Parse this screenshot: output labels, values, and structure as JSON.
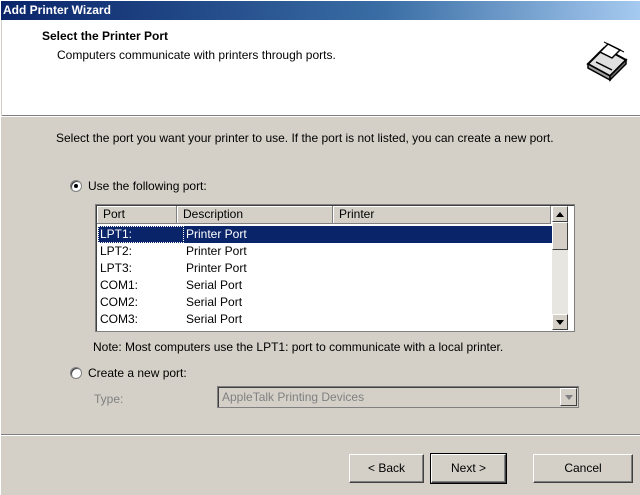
{
  "window": {
    "title": "Add Printer Wizard"
  },
  "header": {
    "title": "Select the Printer Port",
    "subtitle": "Computers communicate with printers through ports.",
    "icon": "printer-icon"
  },
  "intro_text": "Select the port you want your printer to use.  If the port is not listed, you can create a new port.",
  "use_port": {
    "label": "Use the following port:",
    "checked": true
  },
  "port_list": {
    "columns": [
      "Port",
      "Description",
      "Printer"
    ],
    "rows": [
      {
        "port": "LPT1:",
        "description": "Printer Port",
        "printer": "",
        "selected": true
      },
      {
        "port": "LPT2:",
        "description": "Printer Port",
        "printer": ""
      },
      {
        "port": "LPT3:",
        "description": "Printer Port",
        "printer": ""
      },
      {
        "port": "COM1:",
        "description": "Serial Port",
        "printer": ""
      },
      {
        "port": "COM2:",
        "description": "Serial Port",
        "printer": ""
      },
      {
        "port": "COM3:",
        "description": "Serial Port",
        "printer": ""
      }
    ]
  },
  "note": "Note: Most computers use the LPT1: port to communicate with a local printer.",
  "create_port": {
    "label": "Create a new port:",
    "checked": false
  },
  "type": {
    "label": "Type:",
    "value": "AppleTalk Printing Devices"
  },
  "buttons": {
    "back": "< Back",
    "next": "Next >",
    "cancel": "Cancel"
  }
}
